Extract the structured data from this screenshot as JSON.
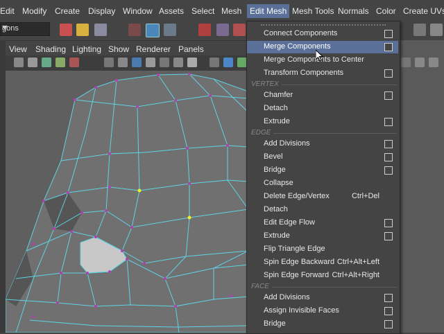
{
  "menubar": {
    "items": [
      "Edit",
      "Modify",
      "Create",
      "Display",
      "Window",
      "Assets",
      "Select",
      "Mesh",
      "Edit Mesh",
      "Mesh Tools",
      "Normals",
      "Color",
      "Create UVs"
    ],
    "active": "Edit Mesh"
  },
  "toolbar": {
    "mode_combo": "gons"
  },
  "panel_menu": {
    "items": [
      "View",
      "Shading",
      "Lighting",
      "Show",
      "Renderer",
      "Panels"
    ]
  },
  "edit_mesh_menu": {
    "components": [
      {
        "label": "Connect Components",
        "has_option": true
      },
      {
        "label": "Merge Components",
        "has_option": true,
        "highlighted": true
      },
      {
        "label": "Merge Components to Center",
        "has_option": false
      },
      {
        "label": "Transform Components",
        "has_option": true
      }
    ],
    "vertex_header": "VERTEX",
    "vertex": [
      {
        "label": "Chamfer",
        "has_option": true
      },
      {
        "label": "Detach",
        "has_option": false
      },
      {
        "label": "Extrude",
        "has_option": true
      }
    ],
    "edge_header": "EDGE",
    "edge": [
      {
        "label": "Add Divisions",
        "has_option": true
      },
      {
        "label": "Bevel",
        "has_option": true
      },
      {
        "label": "Bridge",
        "has_option": true
      },
      {
        "label": "Collapse",
        "has_option": false
      },
      {
        "label": "Delete Edge/Vertex",
        "shortcut": "Ctrl+Del",
        "has_option": false
      },
      {
        "label": "Detach",
        "has_option": false
      },
      {
        "label": "Edit Edge Flow",
        "has_option": true
      },
      {
        "label": "Extrude",
        "has_option": true
      },
      {
        "label": "Flip Triangle Edge",
        "has_option": false
      },
      {
        "label": "Spin Edge Backward",
        "shortcut": "Ctrl+Alt+Left",
        "has_option": false
      },
      {
        "label": "Spin Edge Forward",
        "shortcut": "Ctrl+Alt+Right",
        "has_option": false
      }
    ],
    "face_header": "FACE",
    "face": [
      {
        "label": "Add Divisions",
        "has_option": true
      },
      {
        "label": "Assign Invisible Faces",
        "has_option": true
      },
      {
        "label": "Bridge",
        "has_option": true
      }
    ]
  },
  "colors": {
    "highlight": "#5a7099",
    "wire": "#5fd3e6",
    "vertex": "#b040b0",
    "selected_vertex": "#f0f020"
  }
}
